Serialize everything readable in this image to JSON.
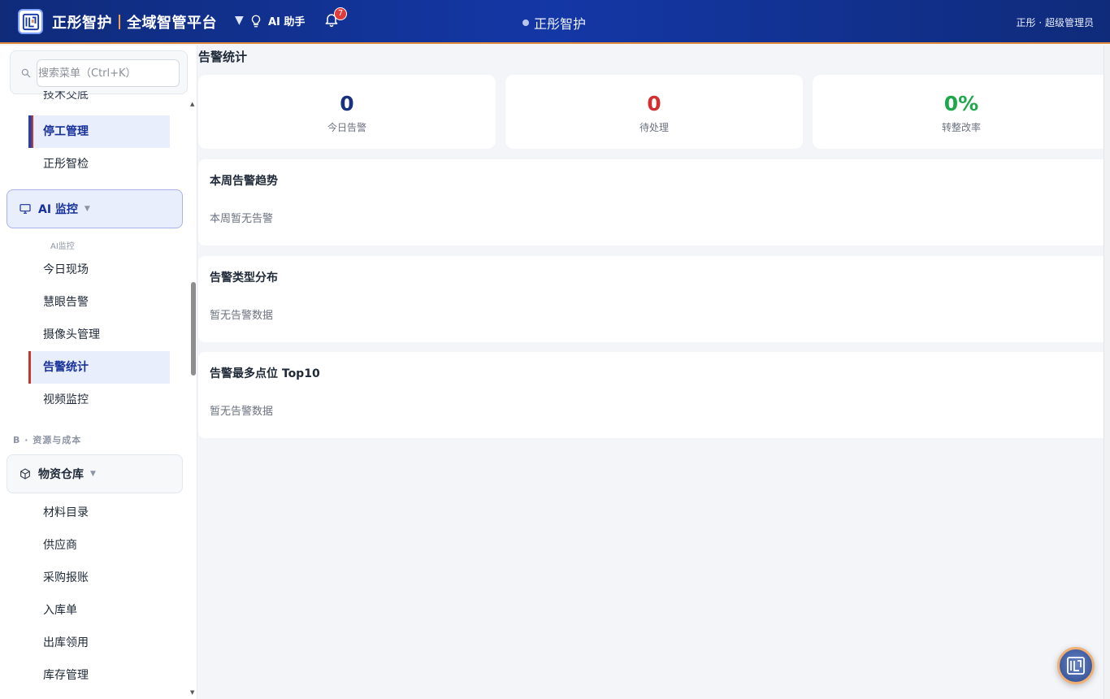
{
  "header": {
    "brand_left": "正彤智护",
    "brand_right": "全域智管平台",
    "ai_assistant": "AI 助手",
    "notification_count": "7",
    "center_title": "正彤智护",
    "user": "正彤 · 超级管理员"
  },
  "sidebar": {
    "search_placeholder": "搜索菜单（Ctrl+K）",
    "clipped_item": "技术交底",
    "items_top": [
      {
        "label": "停工管理",
        "active": true
      },
      {
        "label": "正彤智检"
      }
    ],
    "ai_group": {
      "label": "AI 监控",
      "subhead": "AI监控"
    },
    "ai_items": [
      {
        "label": "今日现场"
      },
      {
        "label": "慧眼告警"
      },
      {
        "label": "摄像头管理"
      },
      {
        "label": "告警统计",
        "active": true
      },
      {
        "label": "视频监控"
      }
    ],
    "section_b": "B · 资源与成本",
    "materials_group": {
      "label": "物资仓库"
    },
    "material_items": [
      {
        "label": "材料目录"
      },
      {
        "label": "供应商"
      },
      {
        "label": "采购报账"
      },
      {
        "label": "入库单"
      },
      {
        "label": "出库领用"
      },
      {
        "label": "库存管理"
      }
    ]
  },
  "main": {
    "title": "告警统计",
    "stats": [
      {
        "value": "0",
        "label": "今日告警",
        "color": "#17307f"
      },
      {
        "value": "0",
        "label": "待处理",
        "color": "#d32f2f"
      },
      {
        "value": "0%",
        "label": "转整改率",
        "color": "#1fa84b"
      }
    ],
    "panels": [
      {
        "title": "本周告警趋势",
        "empty": "本周暂无告警"
      },
      {
        "title": "告警类型分布",
        "empty": "暂无告警数据"
      },
      {
        "title": "告警最多点位 Top10",
        "empty": "暂无告警数据"
      }
    ]
  },
  "colors": {
    "header_bg": "#1437a6",
    "accent_orange": "#e08a3c",
    "active_bg": "#e8eefb",
    "active_text": "#17309a"
  }
}
